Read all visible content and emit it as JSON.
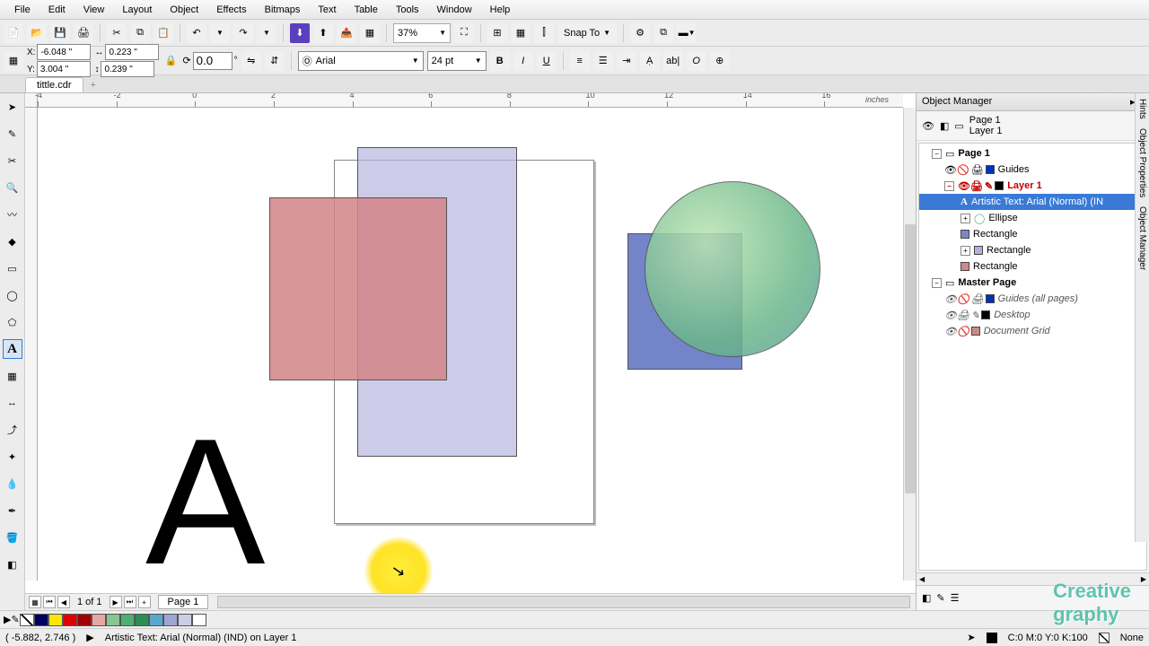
{
  "menu": {
    "items": [
      "File",
      "Edit",
      "View",
      "Layout",
      "Object",
      "Effects",
      "Bitmaps",
      "Text",
      "Table",
      "Tools",
      "Window",
      "Help"
    ]
  },
  "toolbar": {
    "zoom": "37%",
    "snap": "Snap To"
  },
  "props": {
    "x": "-6.048 \"",
    "y": "3.004 \"",
    "w": "0.223 \"",
    "h": "0.239 \"",
    "rot": "0.0",
    "font": "Arial",
    "fontSize": "24 pt"
  },
  "docTab": "tittle.cdr",
  "ruler": {
    "unit": "inches",
    "ticks": [
      "-4",
      "-2",
      "0",
      "2",
      "4",
      "6",
      "8",
      "10",
      "12",
      "14",
      "16"
    ]
  },
  "pageNav": {
    "label": "1 of 1",
    "pageTab": "Page 1"
  },
  "objmgr": {
    "title": "Object Manager",
    "head": {
      "page": "Page 1",
      "layer": "Layer 1"
    },
    "tree": {
      "page": "Page 1",
      "guides": "Guides",
      "layer1": "Layer 1",
      "artText": "Artistic Text: Arial (Normal) (IN",
      "ellipse": "Ellipse",
      "rect1": "Rectangle",
      "rect2": "Rectangle",
      "rect3": "Rectangle",
      "master": "Master Page",
      "guidesAll": "Guides (all pages)",
      "desktop": "Desktop",
      "grid": "Document Grid"
    }
  },
  "paletteColors": [
    "#fff",
    "#000060",
    "#0000c0",
    "#e00000",
    "#a00000",
    "#e6a6a6",
    "#86c790",
    "#4bb071",
    "#2a8f53",
    "#59a7cc",
    "#9da6d0",
    "#c9cde6",
    "#ffffff"
  ],
  "stripColors": [
    "#ffffff",
    "#000000",
    "#003399",
    "#0066cc",
    "#00ccff",
    "#009966",
    "#00cc33",
    "#99ff00",
    "#ffff00",
    "#ff9900",
    "#ff3300",
    "#cc0000",
    "#990066",
    "#660099",
    "#333399",
    "#808080"
  ],
  "status": {
    "coord": "( -5.882, 2.746 )",
    "sel": "Artistic Text: Arial (Normal) (IND) on Layer 1",
    "color": "C:0 M:0 Y:0 K:100",
    "fill": "None"
  },
  "watermark": {
    "a": "Creative",
    "b": "graphy"
  },
  "letter": "A"
}
